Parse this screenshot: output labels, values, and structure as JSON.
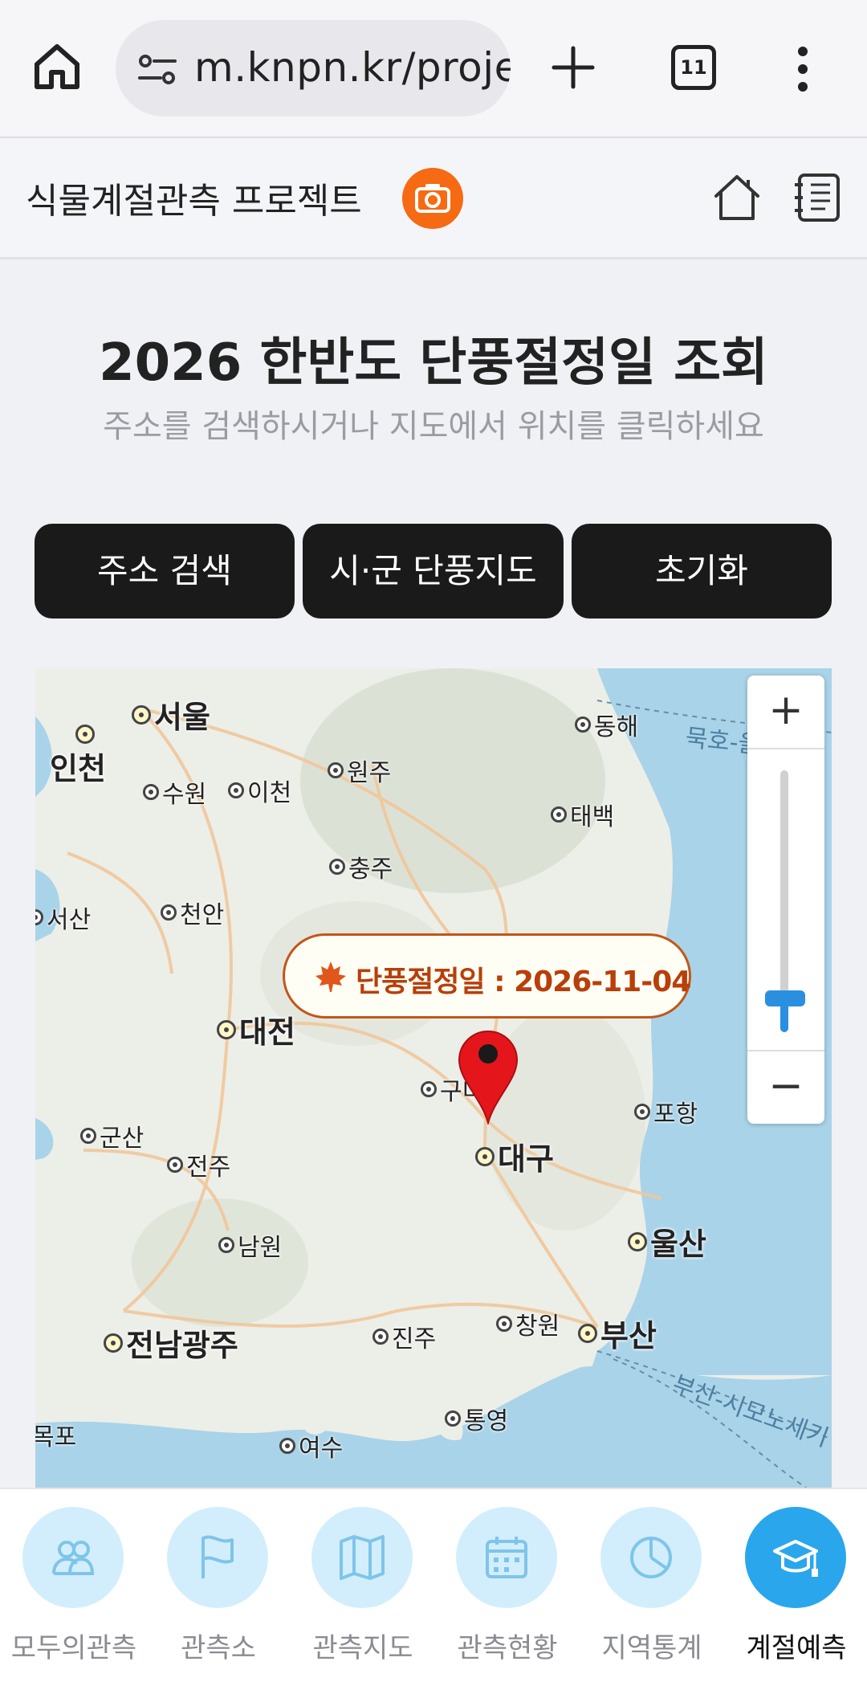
{
  "browser": {
    "url": "m.knpn.kr/proje",
    "tab_count": "11"
  },
  "header": {
    "title": "식물계절관측 프로젝트"
  },
  "main": {
    "title": "2026 한반도 단풍절정일 조회",
    "subtitle": "주소를 검색하시거나 지도에서 위치를 클릭하세요"
  },
  "buttons": {
    "address_search": "주소 검색",
    "city_map": "시·군 단풍지도",
    "reset": "초기화"
  },
  "map": {
    "cities_major": [
      "서울",
      "인천",
      "대전",
      "대구",
      "울산",
      "부산",
      "전남광주"
    ],
    "cities_minor": [
      "수원",
      "이천",
      "원주",
      "동해",
      "태백",
      "충주",
      "천안",
      "서산",
      "구미",
      "포항",
      "군산",
      "전주",
      "남원",
      "진주",
      "창원",
      "통영",
      "여수",
      "목포"
    ],
    "sea_labels": [
      "묵호-울",
      "부산-시모노세키"
    ],
    "popup": "단풍절정일 : 2026-11-04",
    "zoom_plus": "+",
    "zoom_minus": "−",
    "zoom_level_fraction": 0.13
  },
  "colors": {
    "accent_orange": "#f56a12",
    "popup_text": "#b83f0a",
    "nav_active": "#2aa6ec",
    "nav_inactive": "#d2eefc",
    "button_dark": "#1a1a1a",
    "marker_red": "#e4161b"
  },
  "nav": [
    {
      "label": "모두의관측",
      "icon": "people-icon"
    },
    {
      "label": "관측소",
      "icon": "flag-icon"
    },
    {
      "label": "관측지도",
      "icon": "map-icon"
    },
    {
      "label": "관측현황",
      "icon": "calendar-icon"
    },
    {
      "label": "지역통계",
      "icon": "pie-chart-icon"
    },
    {
      "label": "계절예측",
      "icon": "graduation-cap-icon"
    }
  ]
}
